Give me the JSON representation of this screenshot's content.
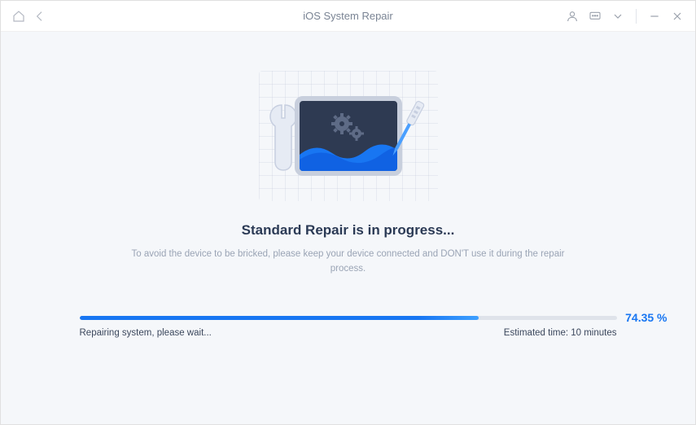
{
  "titlebar": {
    "title": "iOS System Repair"
  },
  "main": {
    "heading": "Standard Repair is in progress...",
    "subtext": "To avoid the device to be bricked, please keep your device connected and DON'T use it during the repair process."
  },
  "progress": {
    "percent_value": 74.35,
    "percent_label": "74.35 %",
    "fill_width_css": "74.35%",
    "status_text": "Repairing system, please wait...",
    "estimated_time_label": "Estimated time: 10 minutes"
  },
  "colors": {
    "accent": "#1876f2",
    "heading": "#2b3a55",
    "muted_text": "#9aa4b5",
    "bg": "#f5f7fa"
  }
}
